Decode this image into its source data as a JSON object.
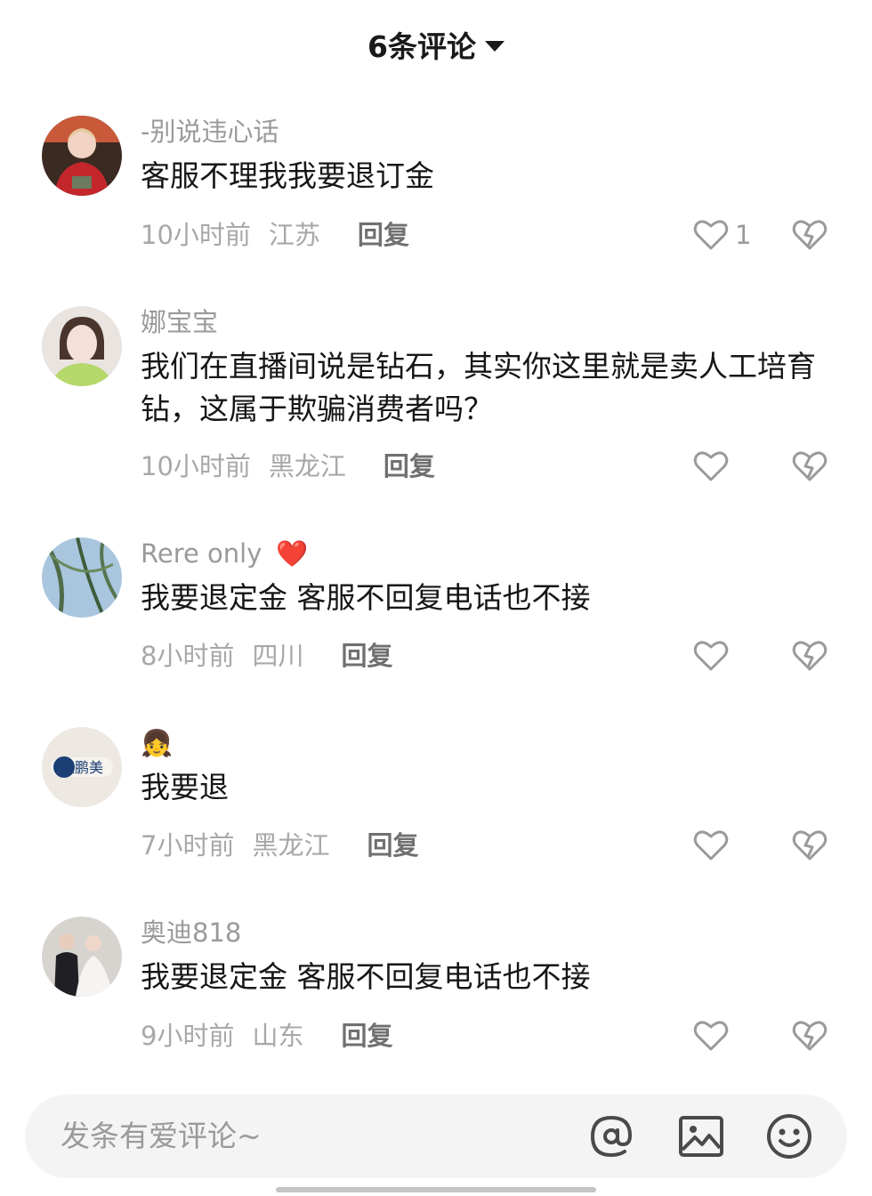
{
  "header": {
    "title": "6条评论"
  },
  "comments": [
    {
      "username": "-别说违心话",
      "text": "客服不理我我要退订金",
      "time": "10小时前",
      "location": "江苏",
      "reply_label": "回复",
      "likes": "1"
    },
    {
      "username": "娜宝宝",
      "text": "我们在直播间说是钻石，其实你这里就是卖人工培育钻，这属于欺骗消费者吗？",
      "time": "10小时前",
      "location": "黑龙江",
      "reply_label": "回复",
      "likes": ""
    },
    {
      "username": "Rere  only",
      "username_emoji": "❤️",
      "text": "我要退定金  客服不回复电话也不接",
      "time": "8小时前",
      "location": "四川",
      "reply_label": "回复",
      "likes": ""
    },
    {
      "username": "👧",
      "text": "我要退",
      "time": "7小时前",
      "location": "黑龙江",
      "reply_label": "回复",
      "likes": "",
      "avatar_text": "张鹏美"
    },
    {
      "username": "奥迪818",
      "text": "我要退定金  客服不回复电话也不接",
      "time": "9小时前",
      "location": "山东",
      "reply_label": "回复",
      "likes": ""
    }
  ],
  "input": {
    "placeholder": "发条有爱评论~"
  },
  "icons": {
    "header": "chevron-down-icon",
    "like": "heart-outline-icon",
    "dislike": "broken-heart-icon",
    "bar": [
      "at-icon",
      "image-icon",
      "emoji-icon"
    ]
  }
}
